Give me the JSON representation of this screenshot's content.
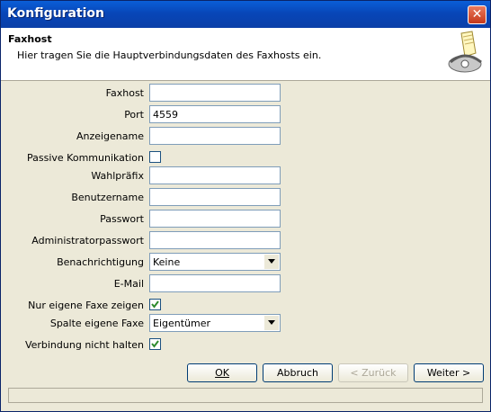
{
  "window": {
    "title": "Konfiguration",
    "close_label": "✕"
  },
  "header": {
    "title": "Faxhost",
    "description": "Hier tragen Sie die Hauptverbindungsdaten des Faxhosts ein."
  },
  "form": {
    "faxhost": {
      "label": "Faxhost",
      "value": ""
    },
    "port": {
      "label": "Port",
      "value": "4559"
    },
    "anzeigename": {
      "label": "Anzeigename",
      "value": ""
    },
    "passive": {
      "label": "Passive Kommunikation",
      "checked": false
    },
    "wahlpraefix": {
      "label": "Wahlpräfix",
      "value": ""
    },
    "benutzername": {
      "label": "Benutzername",
      "value": ""
    },
    "passwort": {
      "label": "Passwort",
      "value": ""
    },
    "adminpasswort": {
      "label": "Administratorpasswort",
      "value": ""
    },
    "benachrichtigung": {
      "label": "Benachrichtigung",
      "value": "Keine"
    },
    "email": {
      "label": "E-Mail",
      "value": ""
    },
    "nur_eigene": {
      "label": "Nur eigene Faxe zeigen",
      "checked": true
    },
    "spalte": {
      "label": "Spalte eigene Faxe",
      "value": "Eigentümer"
    },
    "verbindung": {
      "label": "Verbindung nicht halten",
      "checked": true
    }
  },
  "buttons": {
    "ok": "OK",
    "abbruch": "Abbruch",
    "zurueck": "< Zurück",
    "weiter": "Weiter >"
  },
  "colors": {
    "title_bar": "#0a4fc4",
    "background": "#ece9d8",
    "check": "#2e8b2e"
  }
}
